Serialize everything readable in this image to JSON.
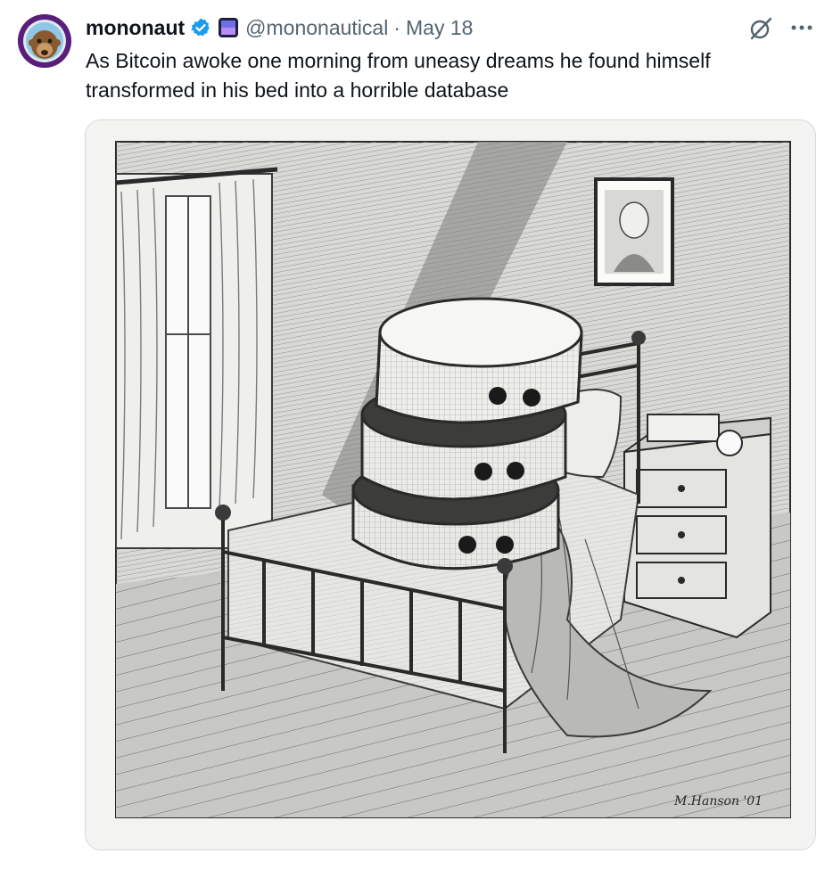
{
  "tweet": {
    "display_name": "mononaut",
    "handle": "@mononautical",
    "separator": "·",
    "date": "May 18",
    "text": "As Bitcoin awoke one morning from uneasy dreams he found himself transformed in his bed into a horrible database"
  },
  "icons": {
    "verified": "verified-badge-icon",
    "affiliation": "affiliation-badge-icon",
    "grok": "grok-icon",
    "more": "more-options-icon"
  },
  "colors": {
    "verified_blue": "#1d9bf0",
    "secondary_text": "#536471",
    "avatar_bg": "#5a1d7a"
  },
  "media": {
    "signature": "M.Hanson '01"
  }
}
